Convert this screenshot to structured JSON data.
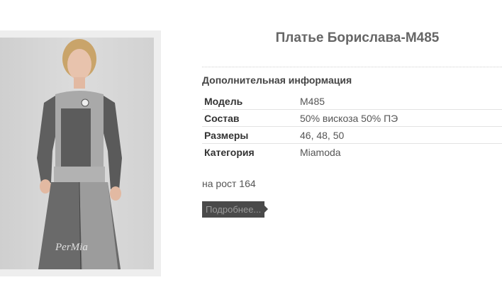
{
  "product": {
    "title": "Платье Борислава-М485",
    "image_alt": "Платье Борислава-М485",
    "watermark": "PerMia"
  },
  "info": {
    "heading": "Дополнительная информация",
    "rows": [
      {
        "label": "Модель",
        "value": "M485"
      },
      {
        "label": "Состав",
        "value": "50% вискоза 50% ПЭ"
      },
      {
        "label": "Размеры",
        "value": "46, 48, 50"
      },
      {
        "label": "Категория",
        "value": "Miamoda"
      }
    ]
  },
  "height_note": "на рост 164",
  "more_button": "Подробнее..."
}
